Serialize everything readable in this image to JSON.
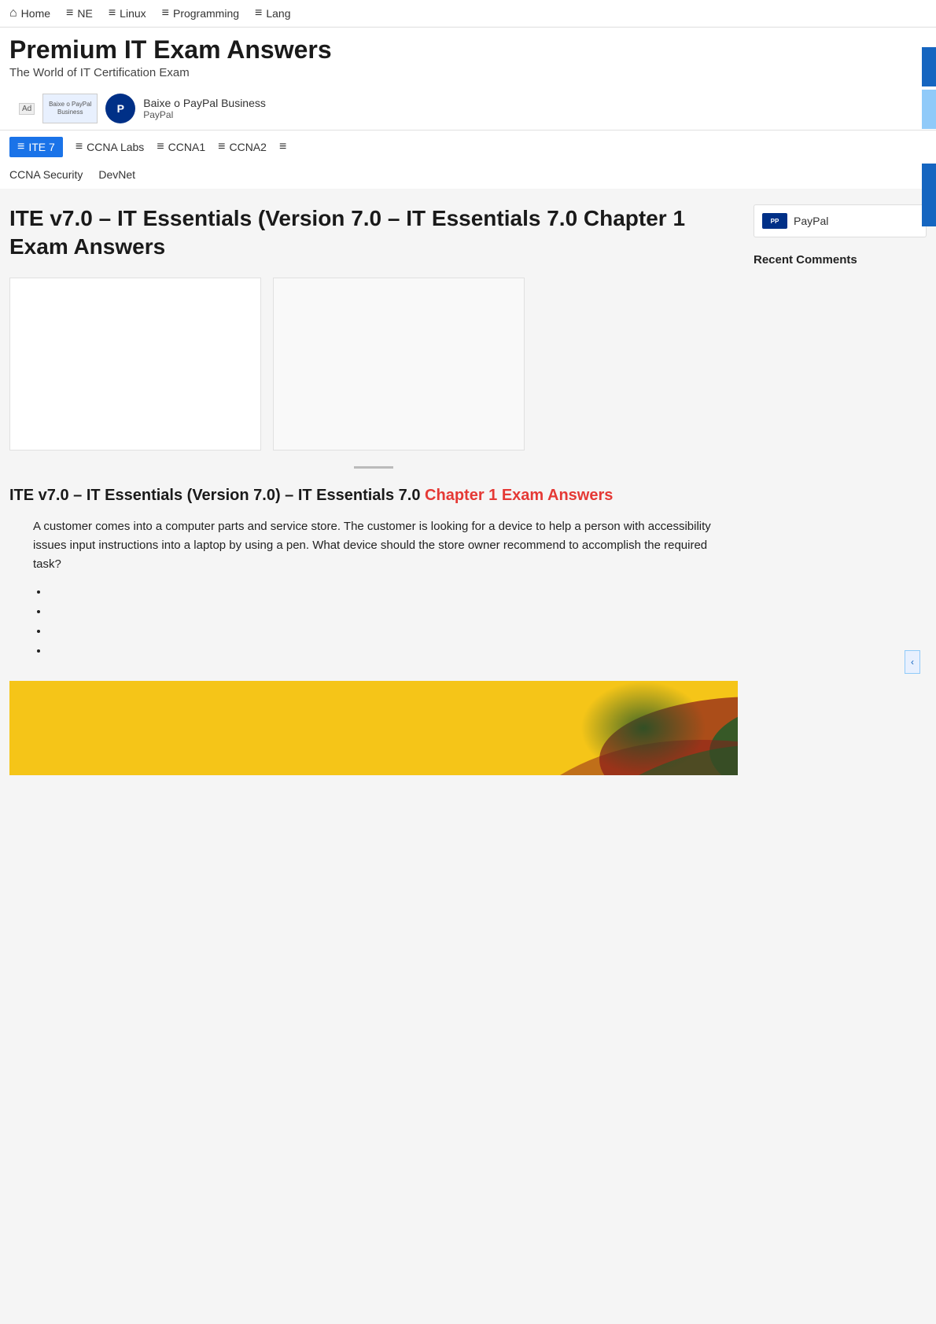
{
  "site": {
    "title": "Premium IT Exam Answers",
    "subtitle": "The World of IT Certification Exam"
  },
  "topNav": {
    "items": [
      {
        "id": "home",
        "label": "Home",
        "icon": "home"
      },
      {
        "id": "ne",
        "label": "NE",
        "icon": "menu"
      },
      {
        "id": "linux",
        "label": "Linux",
        "icon": "menu"
      },
      {
        "id": "programming",
        "label": "Programming",
        "icon": "menu"
      },
      {
        "id": "lang",
        "label": "Lang",
        "icon": "menu"
      }
    ]
  },
  "ad": {
    "badge": "Ad",
    "logo_text": "Baixe o PayPal Business",
    "title": "Baixe o PayPal Business",
    "sub": "PayPal"
  },
  "secondaryNav": {
    "row1": [
      {
        "id": "ite7",
        "label": "ITE 7",
        "icon": "menu",
        "active": true
      },
      {
        "id": "ccnalabs",
        "label": "CCNA Labs",
        "icon": "menu",
        "active": false
      },
      {
        "id": "ccna1",
        "label": "CCNA1",
        "icon": "menu",
        "active": false
      },
      {
        "id": "ccna2",
        "label": "CCNA2",
        "icon": "menu",
        "active": false
      },
      {
        "id": "more",
        "label": "",
        "icon": "menu",
        "active": false
      }
    ],
    "row2": [
      {
        "id": "ccnasecurity",
        "label": "CCNA Security",
        "active": false
      },
      {
        "id": "devnet",
        "label": "DevNet",
        "active": false
      }
    ]
  },
  "pageTitle": "ITE v7.0 – IT Essentials (Version 7.0 – IT Essentials 7.0 Chapter 1 Exam Answers",
  "sidebar": {
    "paypal_label": "PayPal",
    "recent_comments_title": "Recent Comments"
  },
  "article": {
    "subtitle_plain": "ITE v7.0 – IT Essentials (Version 7.0) – IT Essentials 7.0 ",
    "subtitle_highlight": "Chapter 1 Exam Answers",
    "question": "A customer comes into a computer parts and service store. The customer is looking for a device to help a person with accessibility issues input instructions into a laptop by using a pen. What device should the store owner recommend to accomplish the required task?",
    "bullets": [
      "",
      "",
      "",
      ""
    ]
  },
  "icons": {
    "home": "⌂",
    "menu": "≡",
    "chevron_left": "‹"
  }
}
